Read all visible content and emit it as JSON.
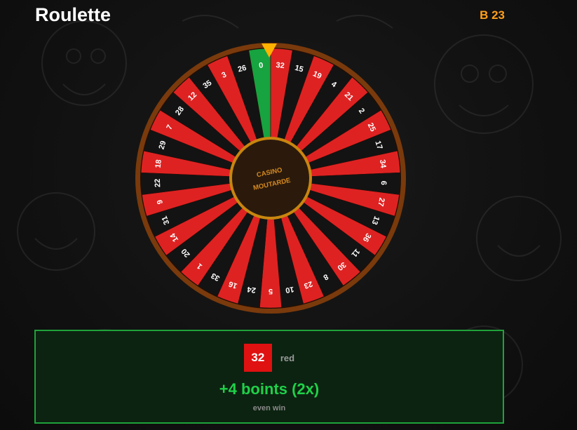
{
  "app": {
    "title": "Roulette",
    "balance": "B 23"
  },
  "wheel": {
    "hub_line1": "CASINO",
    "hub_line2": "MOUTARDE",
    "pockets": [
      {
        "number": "0",
        "color": "green"
      },
      {
        "number": "32",
        "color": "red"
      },
      {
        "number": "15",
        "color": "black"
      },
      {
        "number": "19",
        "color": "red"
      },
      {
        "number": "4",
        "color": "black"
      },
      {
        "number": "21",
        "color": "red"
      },
      {
        "number": "2",
        "color": "black"
      },
      {
        "number": "25",
        "color": "red"
      },
      {
        "number": "17",
        "color": "black"
      },
      {
        "number": "34",
        "color": "red"
      },
      {
        "number": "6",
        "color": "black"
      },
      {
        "number": "27",
        "color": "red"
      },
      {
        "number": "13",
        "color": "black"
      },
      {
        "number": "36",
        "color": "red"
      },
      {
        "number": "11",
        "color": "black"
      },
      {
        "number": "30",
        "color": "red"
      },
      {
        "number": "8",
        "color": "black"
      },
      {
        "number": "23",
        "color": "red"
      },
      {
        "number": "10",
        "color": "black"
      },
      {
        "number": "5",
        "color": "red"
      },
      {
        "number": "24",
        "color": "black"
      },
      {
        "number": "16",
        "color": "red"
      },
      {
        "number": "33",
        "color": "black"
      },
      {
        "number": "1",
        "color": "red"
      },
      {
        "number": "20",
        "color": "black"
      },
      {
        "number": "14",
        "color": "red"
      },
      {
        "number": "31",
        "color": "black"
      },
      {
        "number": "9",
        "color": "red"
      },
      {
        "number": "22",
        "color": "black"
      },
      {
        "number": "18",
        "color": "red"
      },
      {
        "number": "29",
        "color": "black"
      },
      {
        "number": "7",
        "color": "red"
      },
      {
        "number": "28",
        "color": "black"
      },
      {
        "number": "12",
        "color": "red"
      },
      {
        "number": "35",
        "color": "black"
      },
      {
        "number": "3",
        "color": "red"
      },
      {
        "number": "26",
        "color": "black"
      }
    ],
    "colors": {
      "red": "#de2222",
      "black": "#131313",
      "green": "#17a33f",
      "rim": "#7a3a0c",
      "hub": "#2b1a0c",
      "hub_ring": "#c8860f",
      "pointer": "#ffb300"
    }
  },
  "result": {
    "number": "32",
    "color_label": "red",
    "win_text": "+4 boints (2x)",
    "win_type": "even win",
    "number_color": "#e01111",
    "panel_border": "#1fa23a"
  }
}
